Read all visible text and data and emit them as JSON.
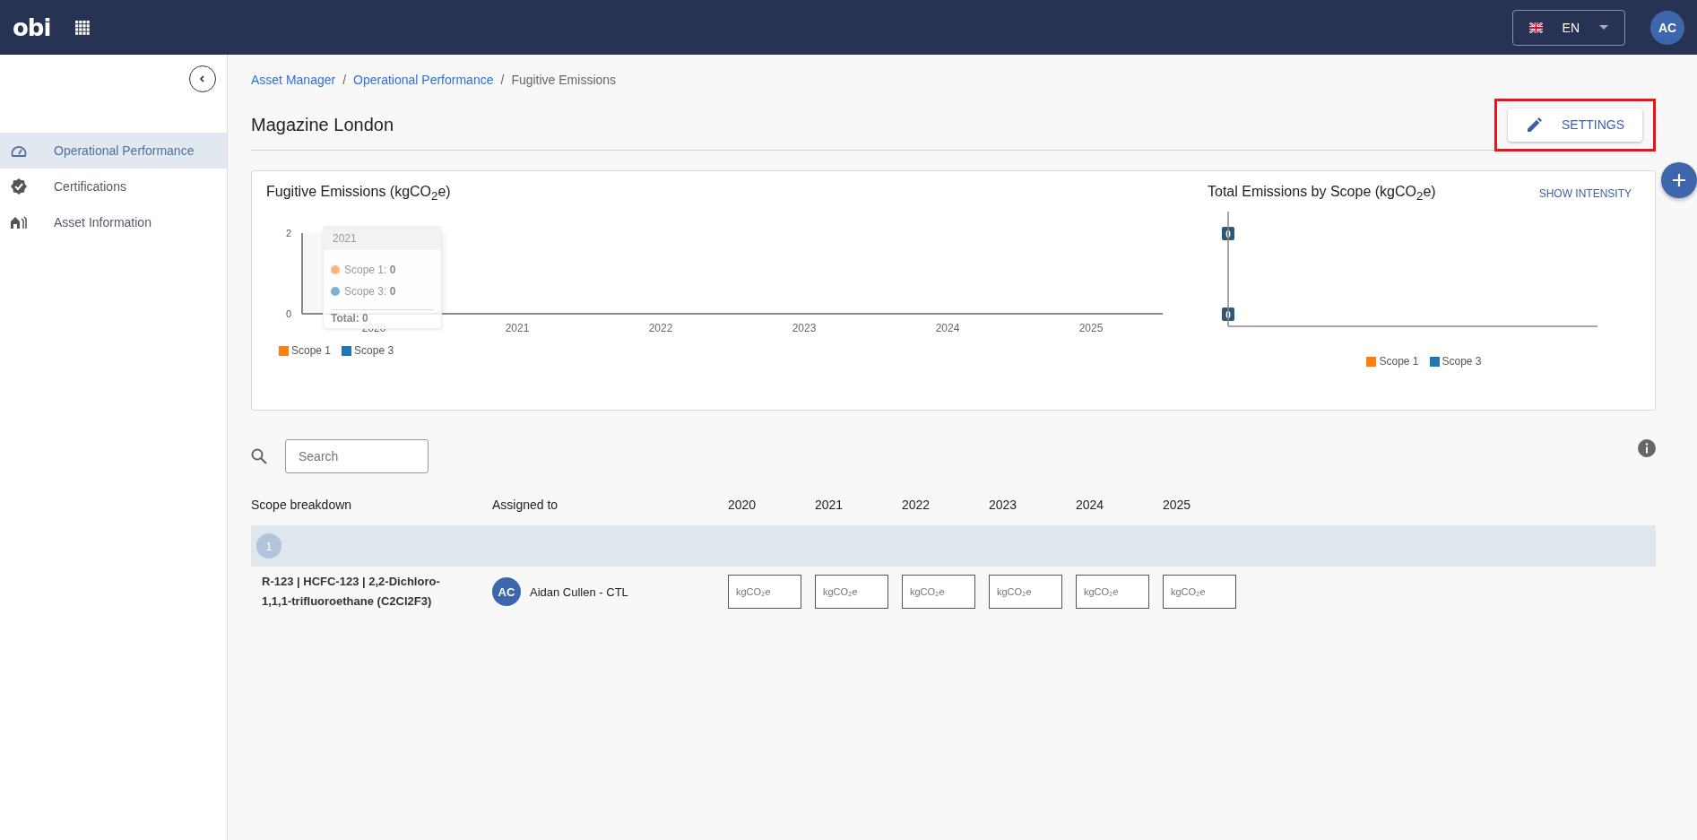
{
  "top_bar": {
    "logo": "obi",
    "language": "EN",
    "avatar": "AC"
  },
  "sidebar": {
    "items": [
      {
        "label": "Operational Performance",
        "selected": true
      },
      {
        "label": "Certifications",
        "selected": false
      },
      {
        "label": "Asset Information",
        "selected": false
      }
    ]
  },
  "breadcrumb": [
    {
      "label": "Asset Manager",
      "current": false
    },
    {
      "separator": "/",
      "label": "Operational Performance",
      "current": false
    },
    {
      "separator": "/",
      "label": "Fugitive Emissions",
      "current": true
    }
  ],
  "page_title": "Magazine London",
  "settings_button": {
    "label": "SETTINGS",
    "highlighted": true
  },
  "fugitive_chart": {
    "title": "Fugitive Emissions (kgCO$_{2}$e)",
    "chart_data": {
      "type": "bar",
      "categories": [
        "2020",
        "2021",
        "2022",
        "2023",
        "2024",
        "2025"
      ],
      "yticks": [
        0,
        2
      ],
      "ylim": [
        0,
        2
      ],
      "series": [
        {
          "name": "Scope 1",
          "color": "#ff7f0e",
          "values": [
            0,
            0,
            0,
            0,
            0,
            0
          ]
        },
        {
          "name": "Scope 3",
          "color": "#1f77b4",
          "values": [
            0,
            0,
            0,
            0,
            0,
            0
          ]
        }
      ]
    },
    "tooltip": {
      "title": "2021",
      "items": [
        {
          "text": "Scope 1: **0**",
          "color": "#ffb47a"
        },
        {
          "text": "Scope 3: **0**",
          "color": "#7fb0d8"
        }
      ],
      "total": "Total: 0"
    }
  },
  "scope_chart": {
    "title": "Total Emissions by Scope (kgCO$_{2}$e)",
    "action": "SHOW INTENSITY",
    "bar_labels": [
      "0",
      "0"
    ],
    "legend": [
      {
        "name": "Scope 1",
        "color": "#ff7f0e"
      },
      {
        "name": "Scope 3",
        "color": "#1f77b4"
      }
    ]
  },
  "search": {
    "placeholder": "Search"
  },
  "table": {
    "columns": [
      "Scope breakdown",
      "Assigned to",
      "2020",
      "2021",
      "2022",
      "2023",
      "2024",
      "2025"
    ],
    "groups": [
      {
        "label": "1",
        "rows": [
          {
            "scope": "R-123 | HCFC-123 | 2,2-Dichloro-1,1,1-trifluoroethane (C2Cl2F3)",
            "assignee_initials": "AC",
            "assignee": "Aidan Cullen - CTL",
            "inputs": [
              {
                "placeholder": "kgCO₂e"
              },
              {
                "placeholder": "kgCO₂e"
              },
              {
                "placeholder": "kgCO₂e"
              },
              {
                "placeholder": "kgCO₂e"
              },
              {
                "placeholder": "kgCO₂e"
              },
              {
                "placeholder": "kgCO₂e"
              }
            ]
          }
        ]
      }
    ]
  }
}
